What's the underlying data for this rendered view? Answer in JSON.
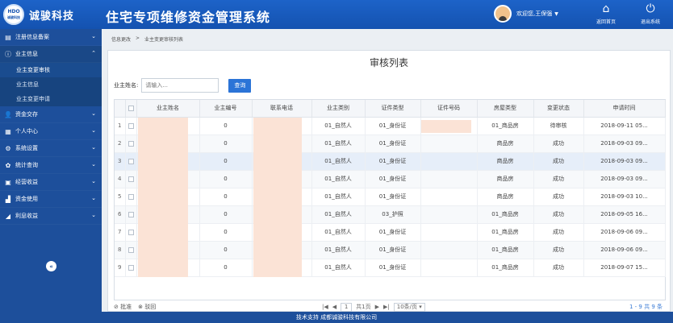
{
  "header": {
    "logo_badge_top": "HDO",
    "logo_badge_bottom": "诚骏科技",
    "logo_text": "诚骏科技",
    "title": "住宅专项维修资金管理系统",
    "welcome": "欢迎您,王保强",
    "home_label": "返回首页",
    "exit_label": "退出系统"
  },
  "sidebar": {
    "items": [
      {
        "label": "注册信息备案",
        "icon": "list-icon"
      },
      {
        "label": "业主信息",
        "icon": "info-icon"
      },
      {
        "label": "资金交存",
        "icon": "user-icon"
      },
      {
        "label": "个人中心",
        "icon": "grid-icon"
      },
      {
        "label": "系统设置",
        "icon": "gear-icon"
      },
      {
        "label": "统计查询",
        "icon": "cog-icon"
      },
      {
        "label": "经营收益",
        "icon": "doc-icon"
      },
      {
        "label": "资金使用",
        "icon": "chart-icon"
      },
      {
        "label": "利息收益",
        "icon": "trend-icon"
      }
    ],
    "sub_items": [
      "业主变更审核",
      "业主信息",
      "业主变更申请"
    ],
    "collapse_glyph": "«"
  },
  "breadcrumb": {
    "first": "信息更改",
    "sep": ">",
    "second": "业主变更审核列表"
  },
  "panel": {
    "title": "审核列表"
  },
  "search": {
    "label": "业主姓名:",
    "placeholder": "请输入...",
    "button": "查询"
  },
  "table": {
    "headers": [
      "业主姓名",
      "业主编号",
      "联系电话",
      "业主类别",
      "证件类型",
      "证件号码",
      "房屋类型",
      "变更状态",
      "申请时间"
    ],
    "rows": [
      {
        "num": "1",
        "name": "",
        "code": "0",
        "phone": "",
        "type": "01_自然人",
        "idtype": "01_身份证",
        "idno": "",
        "house": "01_商品房",
        "status": "待审核",
        "time": "2018-09-11 05..."
      },
      {
        "num": "2",
        "name": "",
        "code": "0",
        "phone": "",
        "type": "01_自然人",
        "idtype": "01_身份证",
        "idno": "",
        "house": "商品房",
        "status": "成功",
        "time": "2018-09-03 09..."
      },
      {
        "num": "3",
        "name": "",
        "code": "0",
        "phone": "",
        "type": "01_自然人",
        "idtype": "01_身份证",
        "idno": "",
        "house": "商品房",
        "status": "成功",
        "time": "2018-09-03 09..."
      },
      {
        "num": "4",
        "name": "",
        "code": "0",
        "phone": "",
        "type": "01_自然人",
        "idtype": "01_身份证",
        "idno": "",
        "house": "商品房",
        "status": "成功",
        "time": "2018-09-03 09..."
      },
      {
        "num": "5",
        "name": "",
        "code": "0",
        "phone": "",
        "type": "01_自然人",
        "idtype": "01_身份证",
        "idno": "",
        "house": "商品房",
        "status": "成功",
        "time": "2018-09-03 10..."
      },
      {
        "num": "6",
        "name": "",
        "code": "0",
        "phone": "",
        "type": "01_自然人",
        "idtype": "03_护照",
        "idno": "",
        "house": "01_商品房",
        "status": "成功",
        "time": "2018-09-05 16..."
      },
      {
        "num": "7",
        "name": "",
        "code": "0",
        "phone": "",
        "type": "01_自然人",
        "idtype": "01_身份证",
        "idno": "",
        "house": "01_商品房",
        "status": "成功",
        "time": "2018-09-06 09..."
      },
      {
        "num": "8",
        "name": "",
        "code": "0",
        "phone": "",
        "type": "01_自然人",
        "idtype": "01_身份证",
        "idno": "",
        "house": "01_商品房",
        "status": "成功",
        "time": "2018-09-06 09..."
      },
      {
        "num": "9",
        "name": "",
        "code": "0",
        "phone": "",
        "type": "01_自然人",
        "idtype": "01_身份证",
        "idno": "",
        "house": "01_商品房",
        "status": "成功",
        "time": "2018-09-07 15..."
      }
    ]
  },
  "actions": {
    "approve": "批准",
    "reject": "驳回"
  },
  "pager": {
    "first": "|◀",
    "prev": "◀",
    "page": "1",
    "total": "共1页",
    "next": "▶",
    "last": "▶|",
    "size": "10条/页",
    "range": "1 - 9  共 9 条"
  },
  "footer": {
    "text": "技术支持 成都诚骏科技有限公司"
  },
  "colors": {
    "header": "#1d63c8",
    "sidebar": "#1d4f9b",
    "button": "#2b74d7",
    "mask": "#fbe3d6"
  }
}
